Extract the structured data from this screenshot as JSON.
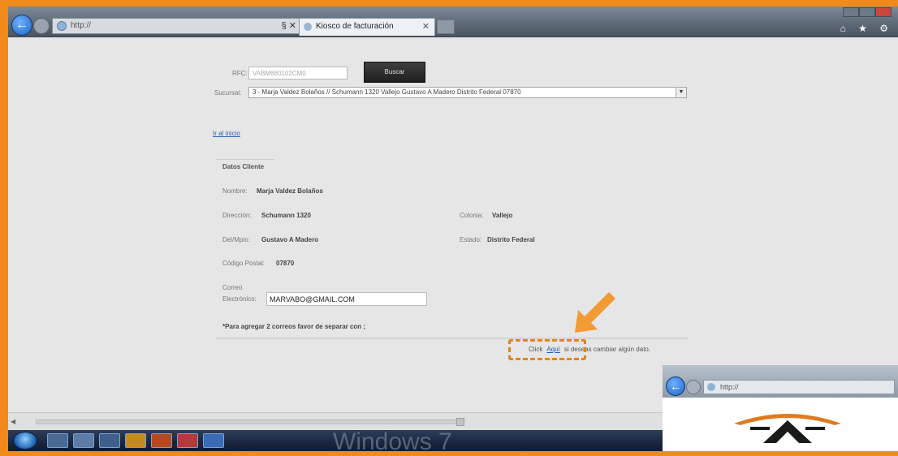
{
  "browser": {
    "address_text": "http://",
    "address_tail": "§ ✕",
    "tab_title": "Kiosco de facturación",
    "tab_close": "✕",
    "back_glyph": "←",
    "nav_right_icons": "⌂ ★ ⚙",
    "icons": {
      "back": "back-arrow-icon",
      "forward": "forward-arrow-icon",
      "site": "globe-icon"
    }
  },
  "form": {
    "rfc_label": "RFC:",
    "rfc_value": "VABM680102CM0",
    "buscar_label": "Buscar",
    "sucursal_label": "Sucursal:",
    "sucursal_value": "3 - Marja Valdez Bolaños // Schumann 1320  Vallejo Gustavo A Madero Distrito Federal 07870",
    "sucursal_arrow": "▼",
    "link_inicio": "Ir al inicio"
  },
  "cliente": {
    "heading": "Datos Cliente",
    "nombre_label": "Nombre:",
    "nombre_value": "Marja Valdez Bolaños",
    "direccion_label": "Dirección:",
    "direccion_value": "Schumann 1320",
    "colonia_label": "Colonia:",
    "colonia_value": "Vallejo",
    "delmpio_label": "Del/Mpio:",
    "delmpio_value": "Gustavo A Madero",
    "estado_label": "Estado:",
    "estado_value": "Distrito Federal",
    "cp_label": "Código Postal:",
    "cp_value": "07870",
    "correo_label_1": "Correo",
    "correo_label_2": "Electrónico:",
    "correo_value": "MARVABO@GMAIL.COM",
    "note": "*Para agregar 2 correos favor de separar con ;"
  },
  "footer": {
    "click_prefix": "Click",
    "aqui_link": "Aquí",
    "click_suffix": "si deseas cambiar algún dato."
  },
  "taskbar": {
    "watermark": "Windows 7"
  },
  "inset": {
    "address_text": "http://",
    "back_glyph": "←"
  },
  "colors": {
    "frame": "#f08a1c",
    "highlight": "#e58417",
    "link": "#2a5db0",
    "button_dark": "#2a2a2a"
  }
}
